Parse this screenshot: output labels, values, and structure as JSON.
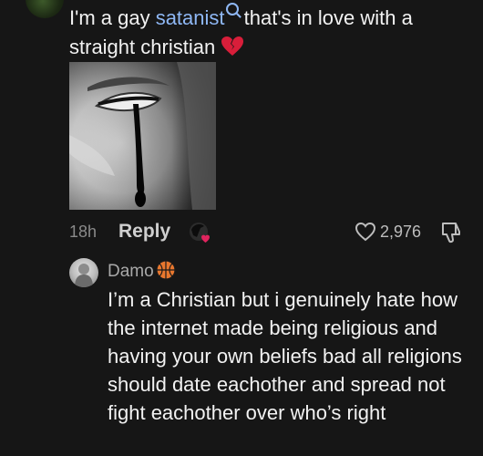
{
  "comment": {
    "text_before": "I'm a gay ",
    "highlight": "satanist",
    "text_after": " that's in love with a straight christian",
    "emoji": "broken-heart-icon",
    "time": "18h",
    "reply_label": "Reply",
    "likes": "2,976"
  },
  "reply": {
    "name": "Damo",
    "name_emoji": "basketball-icon",
    "text": "I’m a Christian but i genuinely hate how the internet made being religious and having your own beliefs bad all religions should date eachother and spread not fight eachother over who’s right"
  },
  "colors": {
    "background": "#161616",
    "link": "#8fb8f5",
    "heart": "#e0245e"
  }
}
